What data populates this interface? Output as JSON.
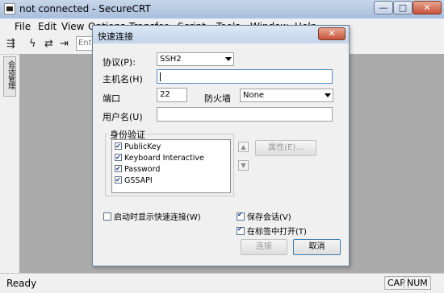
{
  "window": {
    "title": "not connected - SecureCRT"
  },
  "window_controls": {
    "minimize": "—",
    "maximize": "□",
    "close": "✕"
  },
  "menu": [
    "File",
    "Edit",
    "View",
    "Options",
    "Transfer",
    "Script",
    "Tools",
    "Window",
    "Help"
  ],
  "toolbar": {
    "input_placeholder": "Ente"
  },
  "side_tab": "会话管理",
  "dialog": {
    "title": "快速连接",
    "close": "✕",
    "protocol_label": "协议(P):",
    "protocol_value": "SSH2",
    "hostname_label": "主机名(H)",
    "hostname_value": "",
    "port_label": "端口",
    "port_value": "22",
    "firewall_label": "防火墙",
    "firewall_value": "None",
    "username_label": "用户名(U)",
    "username_value": "",
    "auth_group_label": "身份验证",
    "auth_methods": [
      {
        "label": "PublicKey",
        "checked": true
      },
      {
        "label": "Keyboard Interactive",
        "checked": true
      },
      {
        "label": "Password",
        "checked": true
      },
      {
        "label": "GSSAPI",
        "checked": true
      }
    ],
    "properties_button": "属性(E)...",
    "show_on_startup": {
      "label": "启动时显示快速连接(W)",
      "checked": false
    },
    "save_session": {
      "label": "保存会话(V)",
      "checked": true
    },
    "open_in_tab": {
      "label": "在标签中打开(T)",
      "checked": true
    },
    "connect_button": "连接",
    "cancel_button": "取消"
  },
  "status": {
    "text": "Ready",
    "cap": "CAP",
    "num": "NUM"
  }
}
